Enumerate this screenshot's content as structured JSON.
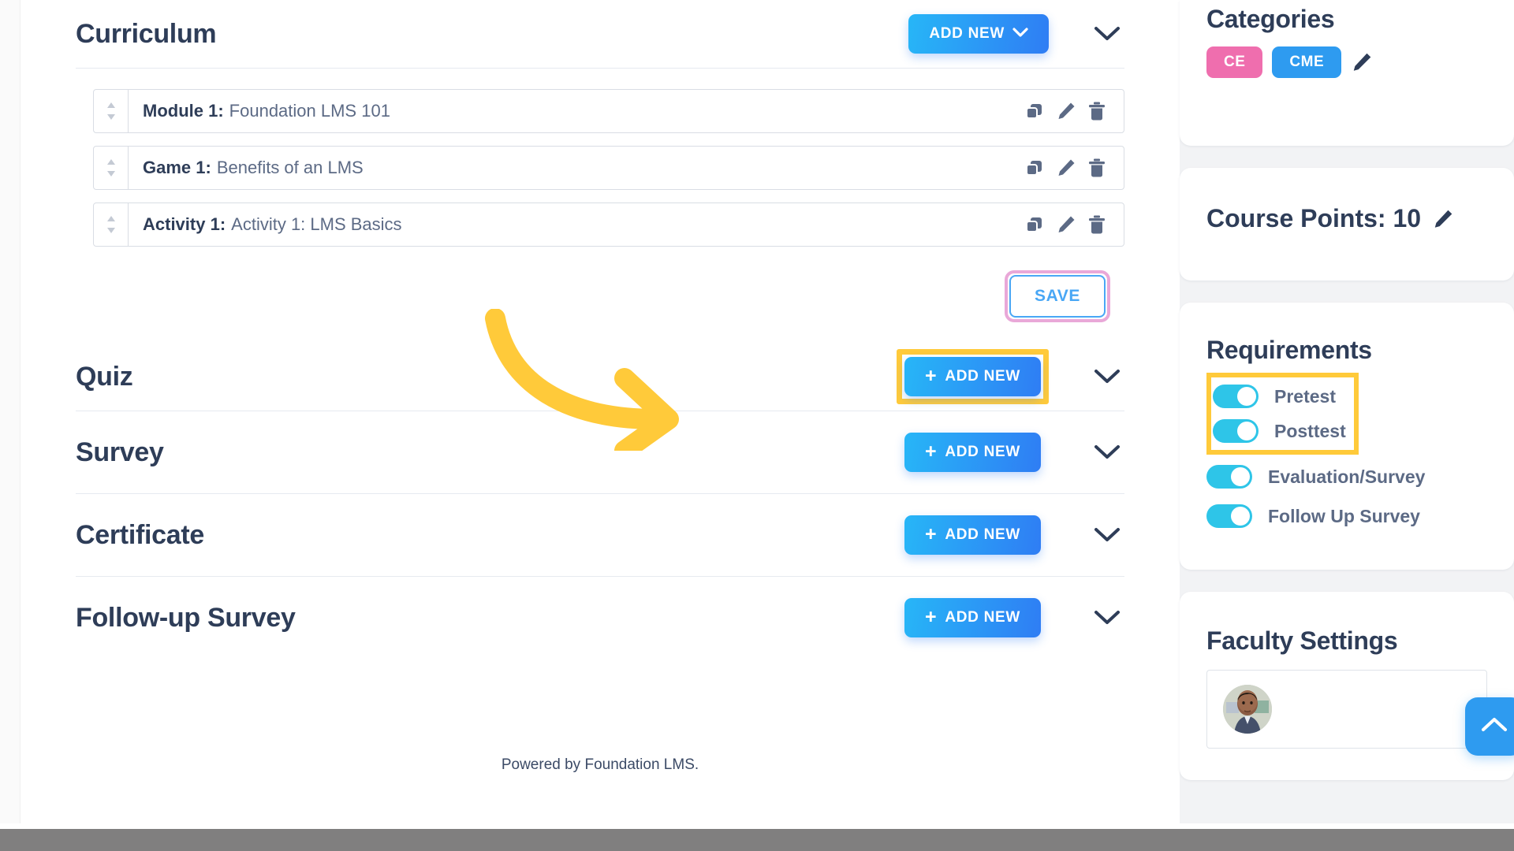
{
  "main": {
    "curriculum": {
      "title": "Curriculum",
      "add_new_label": "ADD NEW",
      "rows": [
        {
          "prefix": "Module 1:",
          "name": "Foundation LMS 101"
        },
        {
          "prefix": "Game 1:",
          "name": "Benefits of an LMS"
        },
        {
          "prefix": "Activity 1:",
          "name": "Activity 1: LMS Basics"
        }
      ],
      "save_label": "SAVE"
    },
    "sections": [
      {
        "title": "Quiz",
        "add_new_label": "ADD NEW",
        "highlighted": true
      },
      {
        "title": "Survey",
        "add_new_label": "ADD NEW",
        "highlighted": false
      },
      {
        "title": "Certificate",
        "add_new_label": "ADD NEW",
        "highlighted": false
      },
      {
        "title": "Follow-up Survey",
        "add_new_label": "ADD NEW",
        "highlighted": false
      }
    ]
  },
  "sidebar": {
    "categories": {
      "title": "Categories",
      "badges": [
        {
          "label": "CE",
          "color": "#ef6eae"
        },
        {
          "label": "CME",
          "color": "#2e9bf0"
        }
      ]
    },
    "course_points": {
      "text": "Course Points: 10"
    },
    "requirements": {
      "title": "Requirements",
      "items": [
        {
          "label": "Pretest",
          "on": true,
          "highlighted": true
        },
        {
          "label": "Posttest",
          "on": true,
          "highlighted": true
        },
        {
          "label": "Evaluation/Survey",
          "on": true,
          "highlighted": false
        },
        {
          "label": "Follow Up Survey",
          "on": true,
          "highlighted": false
        }
      ]
    },
    "faculty": {
      "title": "Faculty Settings"
    }
  },
  "footer": {
    "text": "Powered by Foundation LMS."
  },
  "annotations": {
    "arrow_color": "#ffca3a",
    "highlight_color": "#ffca3a",
    "save_ring_color": "#e9a8d8"
  },
  "icons": {
    "duplicate": "duplicate-icon",
    "edit": "pencil-icon",
    "delete": "trash-icon",
    "drag": "drag-handle-icon",
    "chevron": "chevron-down-icon",
    "scroll_top": "chevron-up-icon"
  }
}
